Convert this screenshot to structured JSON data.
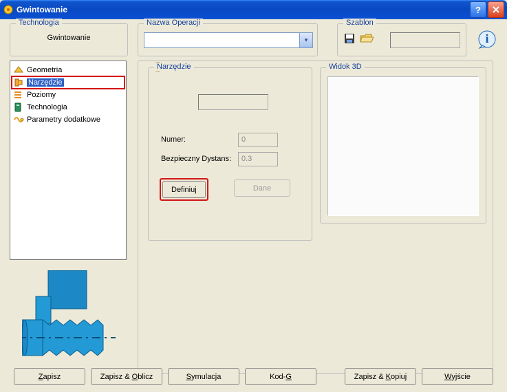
{
  "window": {
    "title": "Gwintowanie"
  },
  "technology": {
    "legend": "Technologia",
    "value": "Gwintowanie"
  },
  "tree": {
    "items": [
      {
        "label": "Geometria",
        "icon": "geometry-icon"
      },
      {
        "label": "Narzędzie",
        "icon": "tool-icon",
        "selected": true
      },
      {
        "label": "Poziomy",
        "icon": "levels-icon"
      },
      {
        "label": "Technologia",
        "icon": "technology-icon"
      },
      {
        "label": "Parametry dodatkowe",
        "icon": "extra-params-icon"
      }
    ]
  },
  "operation": {
    "legend": "Nazwa Operacji",
    "value": ""
  },
  "template": {
    "legend": "Szablon",
    "value": ""
  },
  "tool_panel": {
    "legend": "Narzędzie",
    "name_value": "",
    "numer_label": "Numer:",
    "numer_value": "0",
    "safe_label": "Bezpieczny Dystans:",
    "safe_value": "0.3",
    "define_label": "Definiuj",
    "data_label": "Dane"
  },
  "view3d": {
    "legend": "Widok 3D"
  },
  "buttons": {
    "save": "Zapisz",
    "save_calc": "Zapisz & Oblicz",
    "simulate": "Symulacja",
    "gcode": "Kod-G",
    "save_copy": "Zapisz & Kopiuj",
    "exit": "Wyjście"
  },
  "colors": {
    "accent": "#123f9e",
    "highlight": "#d41414",
    "select_bg": "#2b60c6"
  }
}
